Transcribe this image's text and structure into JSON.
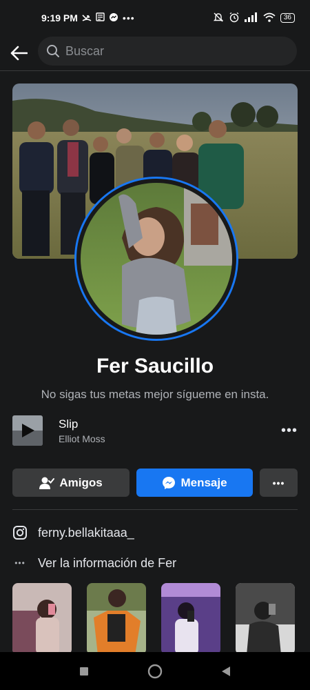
{
  "status_bar": {
    "time": "9:19 PM",
    "battery": "36"
  },
  "search": {
    "placeholder": "Buscar"
  },
  "profile": {
    "name": "Fer Saucillo",
    "bio": "No sigas tus metas mejor sígueme en insta."
  },
  "music": {
    "title": "Slip",
    "artist": "Elliot Moss"
  },
  "actions": {
    "friends_label": "Amigos",
    "message_label": "Mensaje",
    "more_label": "•••"
  },
  "info": {
    "instagram": "ferny.bellakitaaa_",
    "see_info": "Ver la información de Fer",
    "see_info_dots": "•••"
  },
  "colors": {
    "accent": "#1877f2",
    "background": "#18191a",
    "surface": "#3a3b3c"
  },
  "icons": {
    "back": "arrow-left-icon",
    "search": "search-icon",
    "friends": "friends-check-icon",
    "messenger": "messenger-icon",
    "instagram": "instagram-icon",
    "more": "ellipsis-icon"
  }
}
